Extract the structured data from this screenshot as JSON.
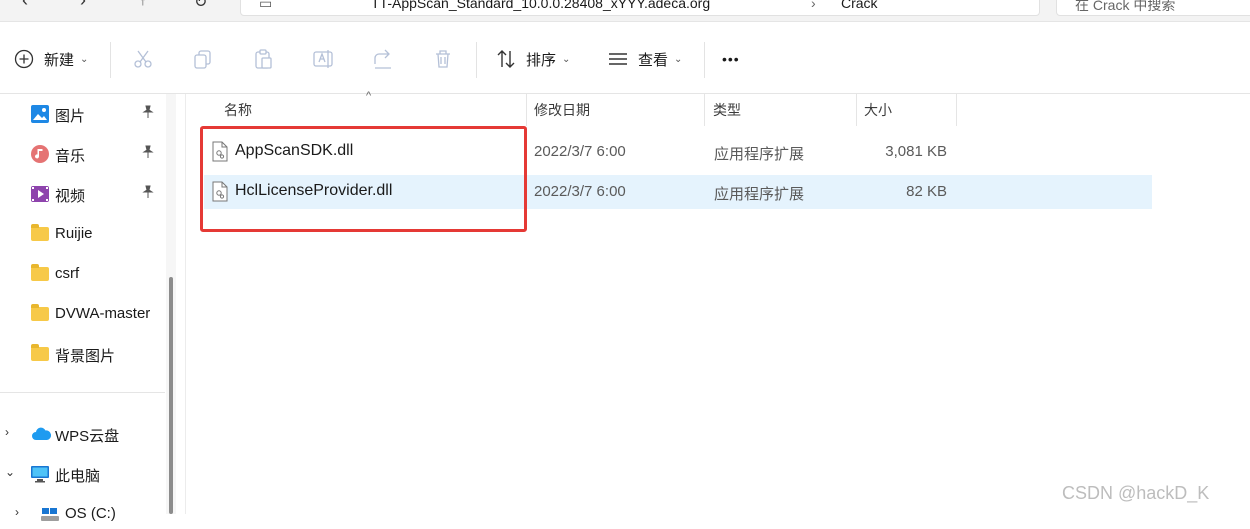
{
  "address_bar": {
    "path_segment": "TT-AppScan_Standard_10.0.0.28408_xYYY.adeca.org",
    "current_folder": "Crack"
  },
  "search": {
    "placeholder": "在 Crack 中搜索"
  },
  "toolbar": {
    "new_label": "新建",
    "sort_label": "排序",
    "view_label": "查看",
    "more_label": "•••"
  },
  "sidebar": {
    "quick_access": [
      {
        "label": "图片",
        "icon": "pictures-icon",
        "pinned": true
      },
      {
        "label": "音乐",
        "icon": "music-icon",
        "pinned": true
      },
      {
        "label": "视频",
        "icon": "video-icon",
        "pinned": true
      },
      {
        "label": "Ruijie",
        "icon": "folder-icon",
        "pinned": false
      },
      {
        "label": "csrf",
        "icon": "folder-icon",
        "pinned": false
      },
      {
        "label": "DVWA-master",
        "icon": "folder-icon",
        "pinned": false
      },
      {
        "label": "背景图片",
        "icon": "folder-icon",
        "pinned": false
      }
    ],
    "locations": [
      {
        "label": "WPS云盘",
        "icon": "cloud-icon",
        "expanded": false
      },
      {
        "label": "此电脑",
        "icon": "computer-icon",
        "expanded": true
      },
      {
        "label": "OS (C:)",
        "icon": "drive-icon",
        "expanded": false
      }
    ]
  },
  "columns": {
    "name": "名称",
    "modified": "修改日期",
    "type": "类型",
    "size": "大小"
  },
  "files": [
    {
      "name": "AppScanSDK.dll",
      "modified": "2022/3/7 6:00",
      "type": "应用程序扩展",
      "size": "3,081 KB",
      "selected": false
    },
    {
      "name": "HclLicenseProvider.dll",
      "modified": "2022/3/7 6:00",
      "type": "应用程序扩展",
      "size": "82 KB",
      "selected": true
    }
  ],
  "watermark": "CSDN @hackD_K",
  "colors": {
    "highlight": "#e53935",
    "selection": "#e5f3fd",
    "folder": "#f7c948"
  }
}
